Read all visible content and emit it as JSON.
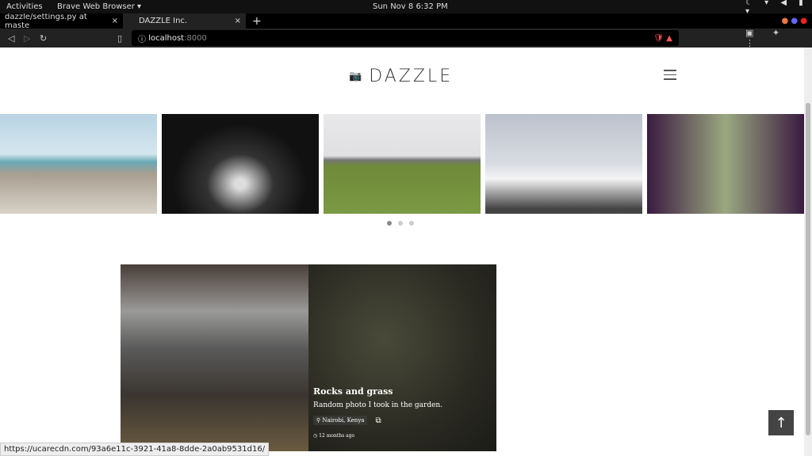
{
  "os": {
    "activities": "Activities",
    "app": "Brave Web Browser ▾",
    "clock": "Sun Nov 8   6:32 PM"
  },
  "tabs": [
    {
      "title": "dazzle/settings.py at maste"
    },
    {
      "title": "DAZZLE Inc."
    }
  ],
  "address": {
    "host": "localhost",
    "port": ":8000"
  },
  "site": {
    "logo": "DAZZLE",
    "carousel_count": 3,
    "carousel_active": 1
  },
  "card": {
    "title": "Rocks and grass",
    "description": "Random photo I took in the garden.",
    "location": "Nairobi, Kenya",
    "time": "12 months ago"
  },
  "status_url": "https://ucarecdn.com/93a6e11c-3921-41a8-8dde-2a0ab9531d16/"
}
